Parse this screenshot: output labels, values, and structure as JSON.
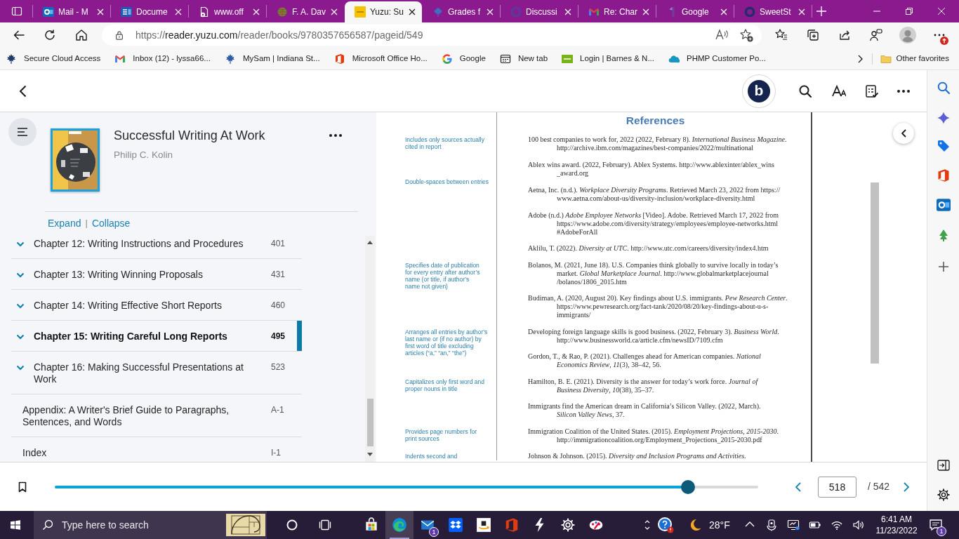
{
  "browser": {
    "tabs": [
      {
        "title": "Mail - M",
        "selected": false
      },
      {
        "title": "Docume",
        "selected": false
      },
      {
        "title": "www.off",
        "selected": false
      },
      {
        "title": "F. A. Dav",
        "selected": false
      },
      {
        "title": "Yuzu: Su",
        "selected": true
      },
      {
        "title": "Grades f",
        "selected": false
      },
      {
        "title": "Discussi",
        "selected": false
      },
      {
        "title": "Re: Char",
        "selected": false
      },
      {
        "title": "Google",
        "selected": false
      },
      {
        "title": "SweetSt",
        "selected": false
      }
    ],
    "address": {
      "scheme": "https://",
      "host": "reader.yuzu.com",
      "path": "/reader/books/9780357656587/pageid/549"
    },
    "favorites": [
      "Secure Cloud Access",
      "Inbox (12) - lyssa66...",
      "MySam | Indiana St...",
      "Microsoft Office Ho...",
      "Google",
      "New tab",
      "Login | Barnes & N...",
      "PHMP Customer Po..."
    ],
    "other_favorites": "Other favorites"
  },
  "reader": {
    "logo_letter": "b",
    "book": {
      "title": "Successful Writing At Work",
      "author": "Philip C. Kolin"
    },
    "toc_controls": {
      "expand": "Expand",
      "separator": "|",
      "collapse": "Collapse"
    },
    "toc": [
      {
        "title": "Chapter 12: Writing Instructions and Procedures",
        "page": "401",
        "expandable": true,
        "selected": false
      },
      {
        "title": "Chapter 13: Writing Winning Proposals",
        "page": "431",
        "expandable": true,
        "selected": false
      },
      {
        "title": "Chapter 14: Writing Effective Short Reports",
        "page": "460",
        "expandable": true,
        "selected": false
      },
      {
        "title": "Chapter 15: Writing Careful Long Reports",
        "page": "495",
        "expandable": true,
        "selected": true
      },
      {
        "title": "Chapter 16: Making Successful Presentations at Work",
        "page": "523",
        "expandable": true,
        "selected": false
      },
      {
        "title": "Appendix: A Writer's Brief Guide to Paragraphs, Sentences, and Words",
        "page": "A-1",
        "expandable": false,
        "selected": false
      },
      {
        "title": "Index",
        "page": "I-1",
        "expandable": false,
        "selected": false
      }
    ],
    "page": {
      "heading": "References",
      "rows": [
        {
          "note": [
            "Includes only sources actually",
            "cited in report"
          ],
          "entry": [
            "100 best companies to work for, 2022 (2022, February 8). *International Business Magazine*.",
            "http://archive.ibm.com/magazines/best-companies/2022/multinational"
          ]
        },
        {
          "entry": [
            "Ablex wins award. (2022, February). Ablex Systems. http://www.ablexinter/ablex_wins",
            "_award.org"
          ]
        },
        {
          "note": [
            "Double-spaces between entries"
          ]
        },
        {
          "entry": [
            "Aetna, Inc. (n.d.). *Workplace Diversity Programs*. Retrieved March 23, 2022 from https://",
            "www.aetna.com/about-us/diversity-inclusion/workplace-diversity.html"
          ]
        },
        {
          "entry": [
            "Adobe (n.d.) *Adobe Employee Networks* [Video]. Adobe. Retrieved March 17, 2022 from",
            "https://www.adobe.com/diversity/strategy/employees/employee-networks.html",
            "#AdobeForAll"
          ]
        },
        {
          "entry": [
            "Aklilu, T. (2022). *Diversity at UTC*. http://www.utc.com/careers/diversity/index4.htm"
          ]
        },
        {
          "note": [
            "Specifies date of publication",
            "for every entry after author’s",
            "name (or title, if author’s",
            "name not given)"
          ],
          "entry": [
            "Bolanos, M. (2021, June 18). U.S. Companies think globally to survive locally in today’s",
            "market. *Global Marketplace Journal*. http://www.globalmarketplacejournal",
            "/bolanos/1806_2015.htm"
          ]
        },
        {
          "entry": [
            "Budiman, A. (2020, August 20). Key findings about U.S. immigrants. *Pew Research Center*.",
            "https://www.pewresearch.org/fact-tank/2020/08/20/key-findings-about-u-s-",
            "immigrants/"
          ]
        },
        {
          "note": [
            "Arranges all entries by author’s",
            "last name or (if no author) by",
            "first word of title excluding",
            "articles (“a,” “an,” “the”)"
          ],
          "entry": [
            "Developing foreign language skills is good business. (2022, February 3). *Business World*.",
            "http://www.businessworld.ca/article.cfm/newsID/7109.cfm"
          ]
        },
        {
          "entry": [
            "Gordon, T., & Rao, P. (2021). Challenges ahead for American companies. *National*",
            "*Economics Review*, *11*(3), 38–42, 56."
          ]
        },
        {
          "note": [
            "Capitalizes only first word and",
            "proper nouns in title"
          ],
          "entry": [
            "Hamilton, B. E. (2021). Diversity is the answer for today’s work force. *Journal of*",
            "*Business Diversity*, *10*(38), 35–37."
          ]
        },
        {
          "entry": [
            "Immigrants find the American dream in California’s Silicon Valley. (2022, March).",
            "*Silicon Valley News*, 37."
          ]
        },
        {
          "note": [
            "Provides page numbers for",
            "print sources"
          ],
          "entry": [
            "Immigration Coalition of the United States. (2015). *Employment Projections, 2015-2030*.",
            "http://immigrationcoalition.org/Employment_Projections_2015-2030.pdf"
          ]
        },
        {
          "note": [
            "Indents second and"
          ],
          "entry": [
            "Johnson & Johnson. (2015). *Diversity and Inclusion Programs and Activities*."
          ]
        }
      ]
    },
    "progress": {
      "level": 0.9
    },
    "page_field": {
      "value": "518",
      "total": "/ 542"
    }
  },
  "taskbar": {
    "search_placeholder": "Type here to search",
    "apps": [
      {
        "active": false
      },
      {
        "active": true
      },
      {
        "active": false,
        "badge": "1"
      },
      {
        "active": false
      },
      {
        "active": false
      },
      {
        "active": false
      },
      {
        "active": false
      },
      {
        "active": false
      },
      {
        "active": false
      }
    ],
    "weather": "28°F",
    "time": "6:41 AM",
    "date": "11/23/2022",
    "notification_badge": "1"
  }
}
